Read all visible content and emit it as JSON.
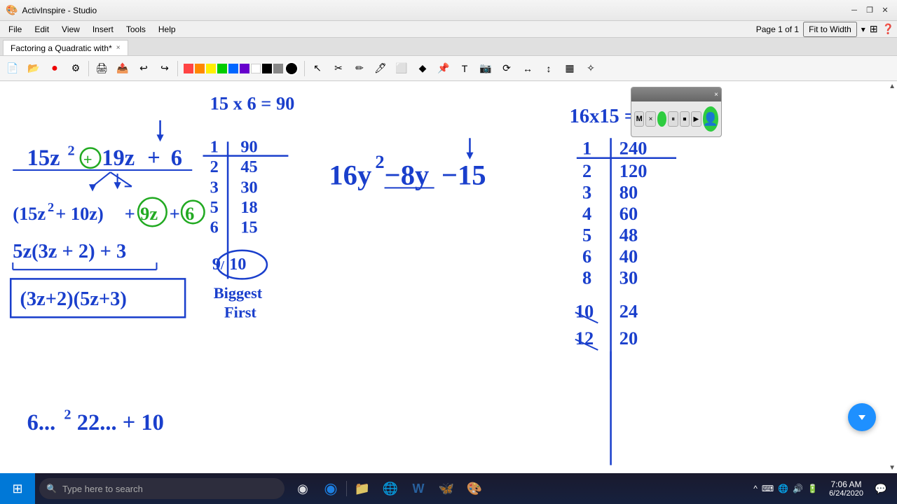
{
  "titleBar": {
    "appName": "ActivInspire - Studio",
    "controls": {
      "minimize": "─",
      "maximize": "❐",
      "close": "✕"
    }
  },
  "menuBar": {
    "items": [
      "File",
      "Edit",
      "View",
      "Insert",
      "Tools",
      "Help"
    ]
  },
  "docTab": {
    "label": "Factoring a Quadratic with*",
    "close": "×"
  },
  "toolbar": {
    "buttons": [
      "📁",
      "📂",
      "🔴",
      "⚙",
      "🖨",
      "↩",
      "↪",
      "🔘",
      "▷",
      "✏",
      "🖊",
      "✦",
      "🔷",
      "📌",
      "📝",
      "⟳",
      "↔",
      "▭",
      "✧"
    ],
    "colors": [
      "#ff0000",
      "#ff8800",
      "#ffff00",
      "#00cc00",
      "#0066ff",
      "#6600cc",
      "#ffffff",
      "#000000",
      "#888888"
    ]
  },
  "pageIndicator": "Page 1 of 1",
  "fitToWidth": "Fit to Width",
  "mediaWidget": {
    "title": "",
    "buttons": [
      "M",
      "×",
      "⏸",
      "⏹",
      "▶"
    ]
  },
  "canvas": {
    "equation1": "15x6 = 90",
    "equation2": "16x15 = 240",
    "mainExpr": "16y² − 8y − 15",
    "factors1": "(3z+2)(5z+3)",
    "biggestFirst": "Biggest\nFirst"
  },
  "taskbar": {
    "startIcon": "⊞",
    "searchPlaceholder": "Type here to search",
    "icons": [
      "🔍",
      "◉",
      "☰",
      "🌐",
      "📁",
      "W",
      "🦅",
      "🎮"
    ],
    "time": "7:06 AM",
    "date": "6/24/2020",
    "sysIcons": [
      "^",
      "🔔",
      "⌨",
      "🌐",
      "🔊",
      "🔋",
      "💬"
    ],
    "notif": "💬"
  },
  "fab": "▼"
}
